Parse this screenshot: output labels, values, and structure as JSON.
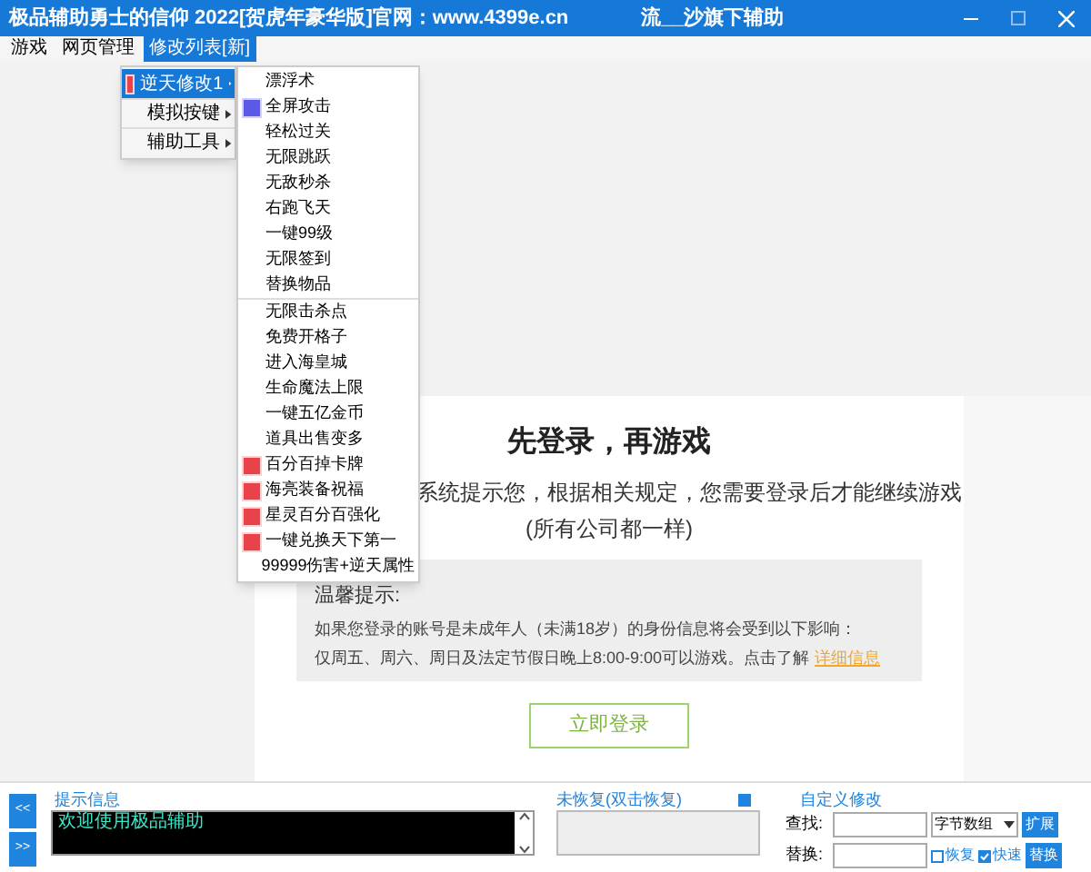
{
  "window": {
    "title": "极品辅助勇士的信仰 2022[贺虎年豪华版]官网：www.4399e.cn",
    "subtitle": "流__沙旗下辅助"
  },
  "menubar": [
    {
      "label": "游戏",
      "selected": false
    },
    {
      "label": "网页管理",
      "selected": false
    },
    {
      "label": "修改列表[新]",
      "selected": true
    }
  ],
  "menu": [
    {
      "label": "逆天修改1",
      "kind": "new",
      "selected": true
    },
    {
      "label": "模拟按键",
      "kind": "plain",
      "selected": false
    },
    {
      "label": "辅助工具",
      "kind": "plain",
      "selected": false
    }
  ],
  "submenu_groups": [
    [
      {
        "label": "漂浮术",
        "kind": "plain"
      },
      {
        "label": "全屏攻击",
        "kind": "shield"
      },
      {
        "label": "轻松过关",
        "kind": "plain"
      },
      {
        "label": "无限跳跃",
        "kind": "plain"
      },
      {
        "label": "无敌秒杀",
        "kind": "plain"
      },
      {
        "label": "右跑飞天",
        "kind": "plain"
      },
      {
        "label": "一键99级",
        "kind": "plain"
      },
      {
        "label": "无限签到",
        "kind": "plain"
      },
      {
        "label": "替换物品",
        "kind": "plain"
      }
    ],
    [
      {
        "label": "无限击杀点",
        "kind": "plain"
      },
      {
        "label": "免费开格子",
        "kind": "plain"
      },
      {
        "label": "进入海皇城",
        "kind": "plain"
      },
      {
        "label": "生命魔法上限",
        "kind": "plain"
      },
      {
        "label": "一键五亿金币",
        "kind": "plain"
      },
      {
        "label": "道具出售变多",
        "kind": "plain"
      },
      {
        "label": "百分百掉卡牌",
        "kind": "new"
      },
      {
        "label": "海亮装备祝福",
        "kind": "new"
      },
      {
        "label": "星灵百分百强化",
        "kind": "new"
      },
      {
        "label": "一键兑换天下第一",
        "kind": "new"
      },
      {
        "label": "99999伤害+逆天属性",
        "kind": "plain"
      }
    ]
  ],
  "login_card": {
    "heading": "先登录，再游戏",
    "notice_line": "系统提示您，根据相关规定，您需要登录后才能继续游戏",
    "notice_sub": "(所有公司都一样)",
    "tip_title": "温馨提示:",
    "tip_line1": "如果您登录的账号是未成年人（未满18岁）的身份信息将会受到以下影响：",
    "tip_line2": "仅周五、周六、周日及法定节假日晚上8:00-9:00可以游戏。点击了解",
    "tip_link": "详细信息",
    "login_button": "立即登录"
  },
  "bottom": {
    "prev": "<<",
    "next": ">>",
    "info_label": "提示信息",
    "info_text": "欢迎使用极品辅助",
    "restore_label": "未恢复(双击恢复)",
    "custom_label": "自定义修改",
    "find_label": "查找:",
    "replace_label": "替换:",
    "type_select": "字节数组",
    "checkboxes": [
      {
        "label": "恢复",
        "checked": false
      },
      {
        "label": "快速",
        "checked": true
      }
    ],
    "extend_button": "扩展",
    "replace_button": "替换"
  }
}
